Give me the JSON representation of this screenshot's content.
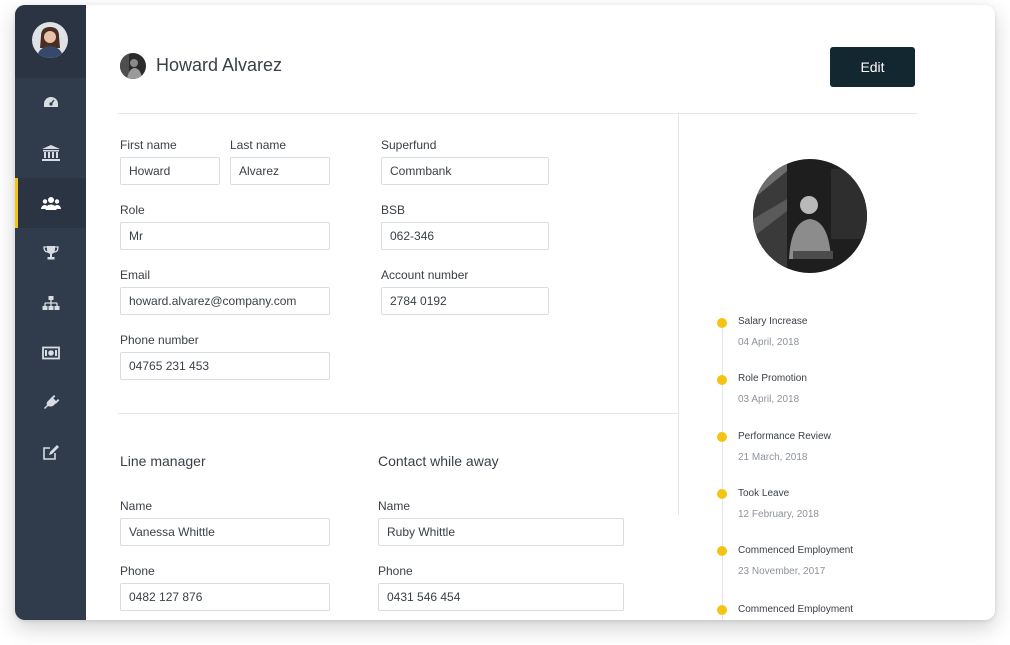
{
  "sidebar": {
    "items": [
      {
        "name": "dashboard",
        "icon": "dashboard-icon"
      },
      {
        "name": "bank",
        "icon": "bank-icon"
      },
      {
        "name": "people",
        "icon": "users-icon",
        "active": true
      },
      {
        "name": "awards",
        "icon": "trophy-icon"
      },
      {
        "name": "org-chart",
        "icon": "sitemap-icon"
      },
      {
        "name": "payroll",
        "icon": "money-icon"
      },
      {
        "name": "integrations",
        "icon": "plug-icon"
      },
      {
        "name": "notes",
        "icon": "edit-icon"
      }
    ],
    "accent": "#f5c314",
    "background": "#303b4b"
  },
  "header": {
    "name": "Howard Alvarez",
    "edit_label": "Edit"
  },
  "details": {
    "first_name_label": "First name",
    "first_name": "Howard",
    "last_name_label": "Last name",
    "last_name": "Alvarez",
    "role_label": "Role",
    "role": "Mr",
    "email_label": "Email",
    "email": "howard.alvarez@company.com",
    "phone_label": "Phone number",
    "phone": "04765 231 453",
    "superfund_label": "Superfund",
    "superfund": "Commbank",
    "bsb_label": "BSB",
    "bsb": "062-346",
    "account_label": "Account number",
    "account": "2784 0192"
  },
  "line_manager": {
    "title": "Line manager",
    "name_label": "Name",
    "name": "Vanessa Whittle",
    "phone_label": "Phone",
    "phone": "0482 127 876"
  },
  "contact_away": {
    "title": "Contact while away",
    "name_label": "Name",
    "name": "Ruby Whittle",
    "phone_label": "Phone",
    "phone": "0431 546 454"
  },
  "timeline": [
    {
      "title": "Salary Increase",
      "date": "04 April, 2018"
    },
    {
      "title": "Role Promotion",
      "date": "03 April, 2018"
    },
    {
      "title": "Performance Review",
      "date": "21 March, 2018"
    },
    {
      "title": "Took Leave",
      "date": "12 February, 2018"
    },
    {
      "title": "Commenced Employment",
      "date": "23 November, 2017"
    },
    {
      "title": "Commenced Employment",
      "date": ""
    }
  ],
  "colors": {
    "edit_button": "#12272f",
    "timeline_dot": "#f5c314"
  }
}
